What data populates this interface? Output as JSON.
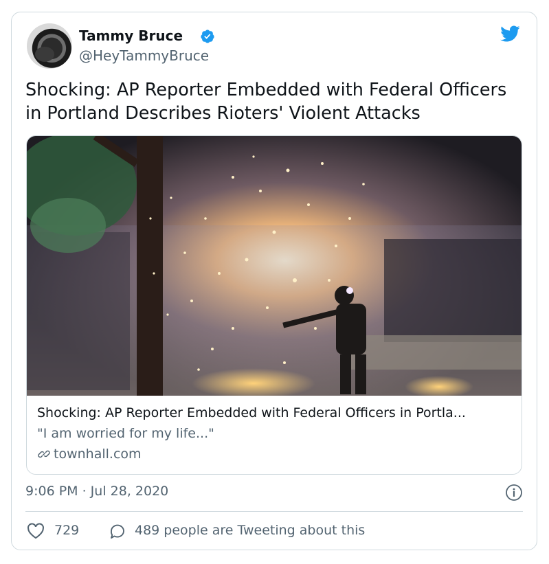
{
  "author": {
    "name": "Tammy Bruce",
    "handle": "@HeyTammyBruce"
  },
  "tweet": {
    "text": "Shocking: AP Reporter Embedded with Federal Officers in Portland Describes Rioters' Violent Attacks"
  },
  "link_card": {
    "title": "Shocking: AP Reporter Embedded with Federal Officers in Portla...",
    "description": "\"I am worried for my life...\"",
    "domain": "townhall.com"
  },
  "meta": {
    "timestamp": "9:06 PM · Jul 28, 2020"
  },
  "stats": {
    "likes": "729",
    "replies_text": "489 people are Tweeting about this"
  },
  "colors": {
    "brand_blue": "#1d9bf0",
    "text_primary": "#0f1419",
    "text_secondary": "#536471",
    "border": "#cfd9de"
  },
  "icons": {
    "verified": "verified-badge-icon",
    "brand": "twitter-bird-icon",
    "link": "link-icon",
    "info": "info-icon",
    "like": "heart-icon",
    "reply": "speech-bubble-icon"
  }
}
